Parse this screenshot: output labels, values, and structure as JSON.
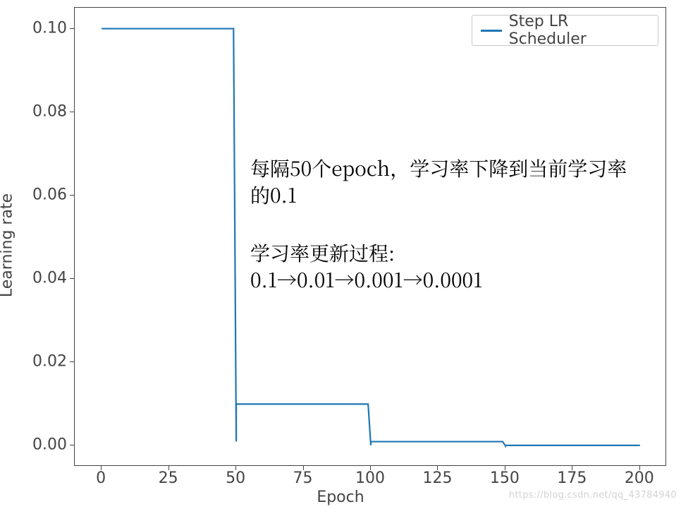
{
  "chart_data": {
    "type": "line",
    "title": "",
    "xlabel": "Epoch",
    "ylabel": "Learning rate",
    "xlim": [
      -10,
      210
    ],
    "ylim": [
      -0.005,
      0.105
    ],
    "x_ticks": [
      0,
      25,
      50,
      75,
      100,
      125,
      150,
      175,
      200
    ],
    "y_ticks": [
      0.0,
      0.02,
      0.04,
      0.06,
      0.08,
      0.1
    ],
    "y_tick_labels": [
      "0.00",
      "0.02",
      "0.04",
      "0.06",
      "0.08",
      "0.10"
    ],
    "series": [
      {
        "name": "Step LR Scheduler",
        "color": "#1f77b4",
        "x": [
          0,
          49,
          50,
          50,
          99,
          100,
          100,
          149,
          150,
          150,
          200
        ],
        "y": [
          0.1,
          0.1,
          0.001,
          0.01,
          0.01,
          0.0001,
          0.001,
          0.001,
          1e-05,
          0.0001,
          0.0001
        ]
      }
    ],
    "legend": {
      "position": "upper right",
      "entries": [
        "Step LR Scheduler"
      ]
    }
  },
  "annotations": {
    "line1": "每隔50个epoch，学习率下降到当前学习率的0.1",
    "line2a": "学习率更新过程:",
    "line2b": "0.1→0.01→0.001→0.0001"
  },
  "watermark": "https://blog.csdn.net/qq_43784940"
}
